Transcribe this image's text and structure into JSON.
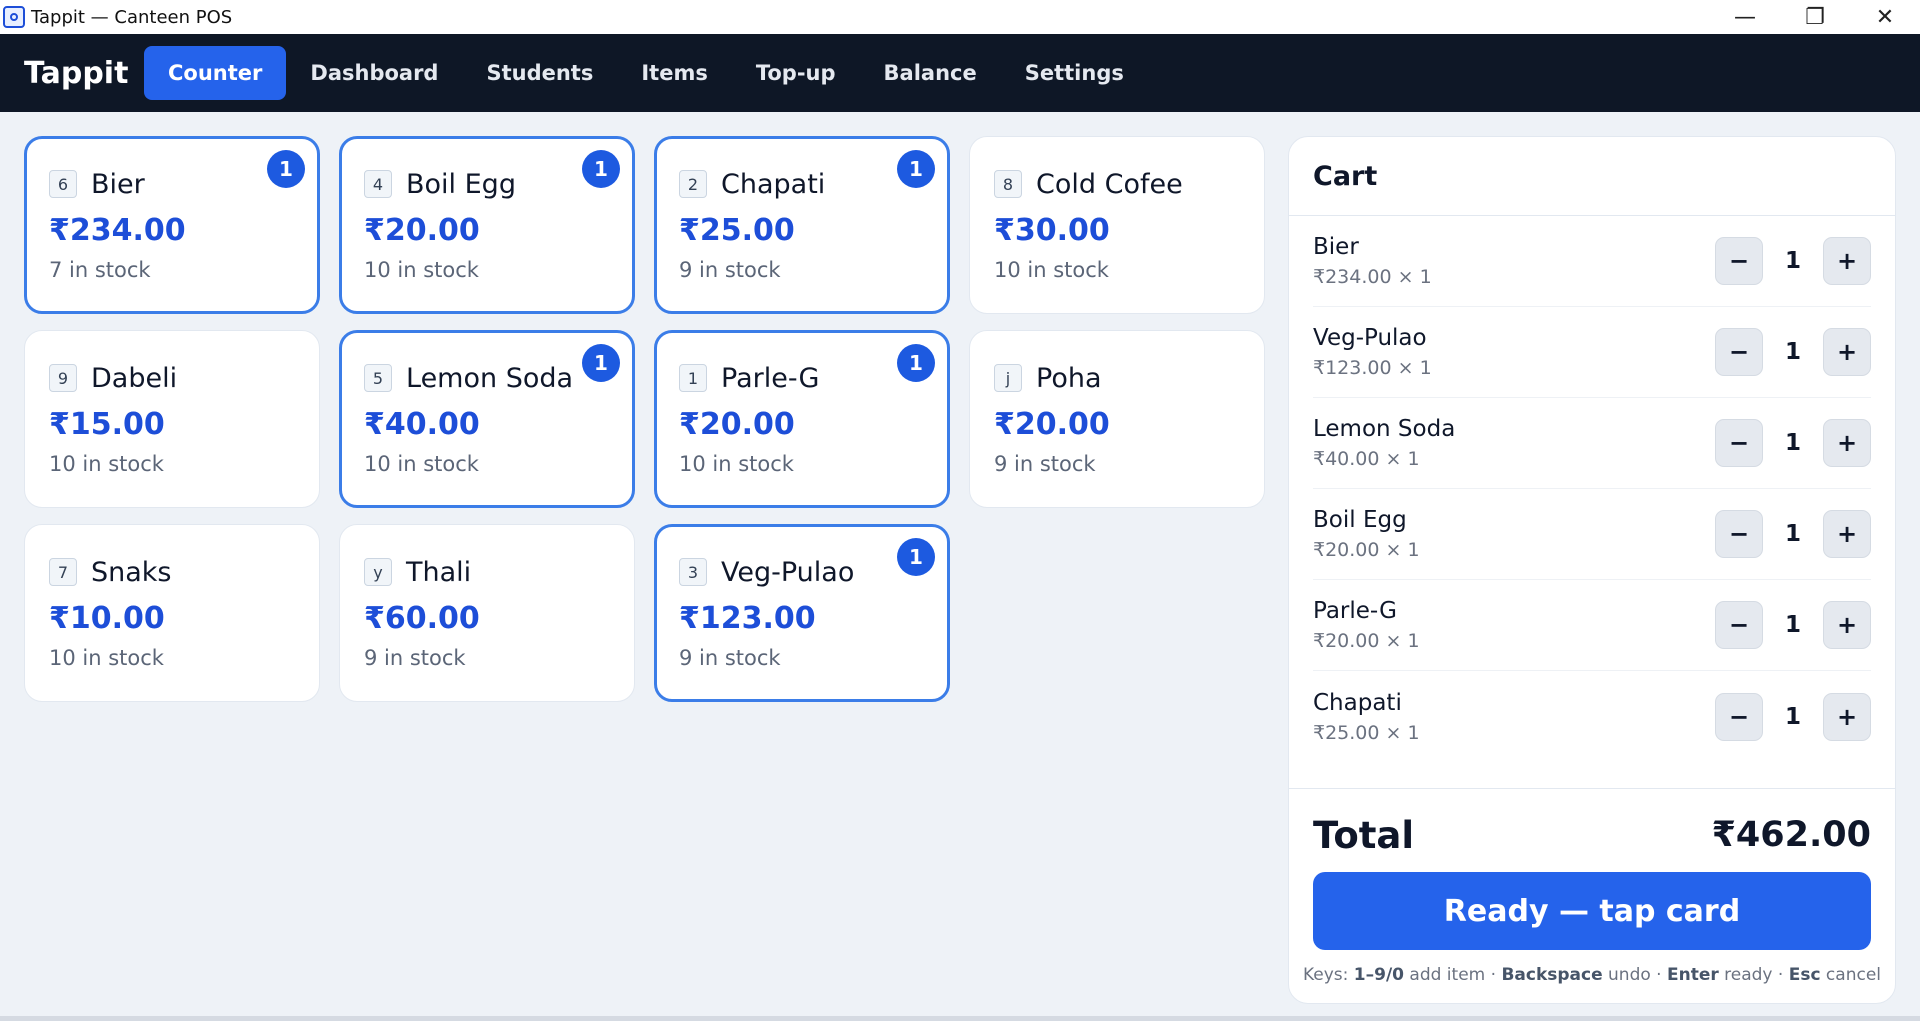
{
  "window": {
    "title": "Tappit — Canteen POS",
    "controls": {
      "minimize": "—",
      "restore": "❐",
      "close": "✕"
    }
  },
  "nav": {
    "brand": "Tappit",
    "tabs": [
      {
        "label": "Counter",
        "active": true
      },
      {
        "label": "Dashboard",
        "active": false
      },
      {
        "label": "Students",
        "active": false
      },
      {
        "label": "Items",
        "active": false
      },
      {
        "label": "Top-up",
        "active": false
      },
      {
        "label": "Balance",
        "active": false
      },
      {
        "label": "Settings",
        "active": false
      }
    ]
  },
  "items": [
    {
      "key": "6",
      "name": "Bier",
      "price": "₹234.00",
      "stock": "7 in stock",
      "selected": true,
      "qty": "1"
    },
    {
      "key": "4",
      "name": "Boil Egg",
      "price": "₹20.00",
      "stock": "10 in stock",
      "selected": true,
      "qty": "1"
    },
    {
      "key": "2",
      "name": "Chapati",
      "price": "₹25.00",
      "stock": "9 in stock",
      "selected": true,
      "qty": "1"
    },
    {
      "key": "8",
      "name": "Cold Cofee",
      "price": "₹30.00",
      "stock": "10 in stock",
      "selected": false,
      "qty": ""
    },
    {
      "key": "9",
      "name": "Dabeli",
      "price": "₹15.00",
      "stock": "10 in stock",
      "selected": false,
      "qty": ""
    },
    {
      "key": "5",
      "name": "Lemon Soda",
      "price": "₹40.00",
      "stock": "10 in stock",
      "selected": true,
      "qty": "1"
    },
    {
      "key": "1",
      "name": "Parle-G",
      "price": "₹20.00",
      "stock": "10 in stock",
      "selected": true,
      "qty": "1"
    },
    {
      "key": "j",
      "name": "Poha",
      "price": "₹20.00",
      "stock": "9 in stock",
      "selected": false,
      "qty": ""
    },
    {
      "key": "7",
      "name": "Snaks",
      "price": "₹10.00",
      "stock": "10 in stock",
      "selected": false,
      "qty": ""
    },
    {
      "key": "y",
      "name": "Thali",
      "price": "₹60.00",
      "stock": "9 in stock",
      "selected": false,
      "qty": ""
    },
    {
      "key": "3",
      "name": "Veg-Pulao",
      "price": "₹123.00",
      "stock": "9 in stock",
      "selected": true,
      "qty": "1"
    }
  ],
  "cart": {
    "title": "Cart",
    "minus_label": "−",
    "plus_label": "+",
    "rows": [
      {
        "name": "Bier",
        "detail": "₹234.00 × 1",
        "qty": "1"
      },
      {
        "name": "Veg-Pulao",
        "detail": "₹123.00 × 1",
        "qty": "1"
      },
      {
        "name": "Lemon Soda",
        "detail": "₹40.00 × 1",
        "qty": "1"
      },
      {
        "name": "Boil Egg",
        "detail": "₹20.00 × 1",
        "qty": "1"
      },
      {
        "name": "Parle-G",
        "detail": "₹20.00 × 1",
        "qty": "1"
      },
      {
        "name": "Chapati",
        "detail": "₹25.00 × 1",
        "qty": "1"
      }
    ],
    "total_label": "Total",
    "total_value": "₹462.00",
    "ready_label": "Ready — tap card",
    "hint": {
      "prefix": "Keys: ",
      "keys_add": "1–9/0",
      "add_text": " add item · ",
      "keys_undo": "Backspace",
      "undo_text": " undo · ",
      "keys_ready": "Enter",
      "ready_text": " ready · ",
      "keys_cancel": "Esc",
      "cancel_text": " cancel"
    }
  },
  "colors": {
    "accent": "#2563eb",
    "nav_bg": "#0e1726",
    "price": "#1d4ed8",
    "page_bg": "#eef2f7"
  }
}
